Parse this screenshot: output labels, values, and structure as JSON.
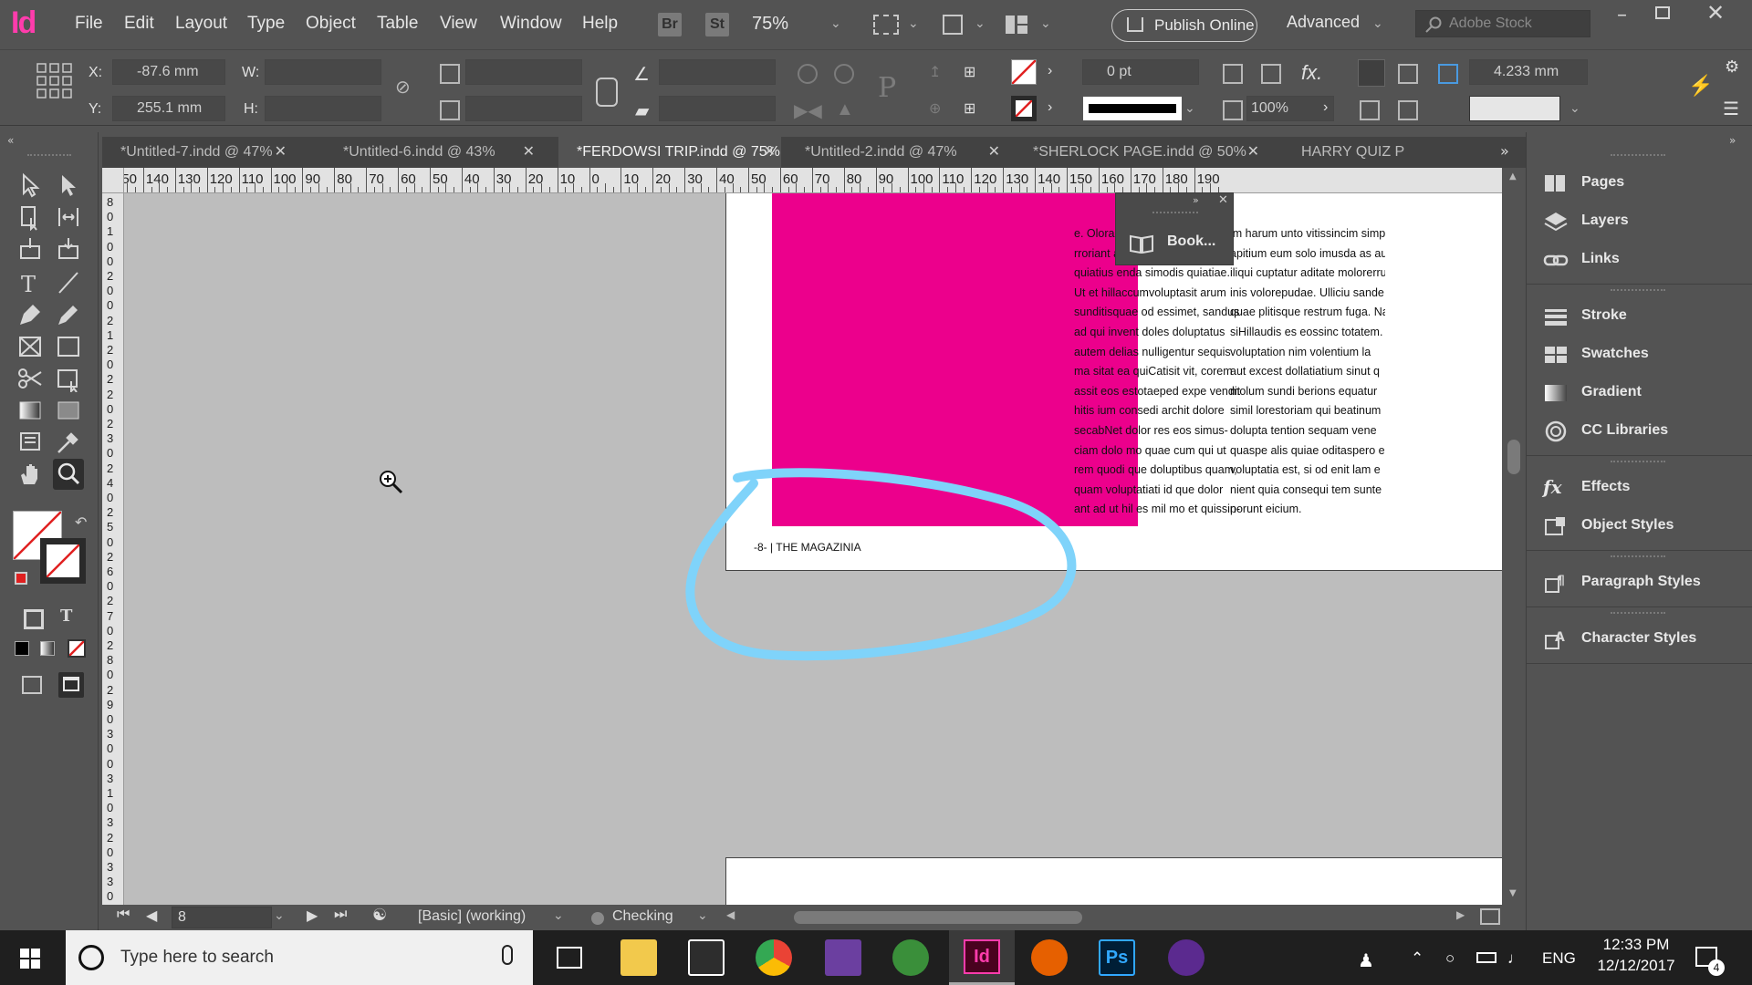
{
  "app": {
    "logo": "Id",
    "menu": [
      "File",
      "Edit",
      "Layout",
      "Type",
      "Object",
      "Table",
      "View",
      "Window",
      "Help"
    ],
    "bridge_label": "Br",
    "stock_label": "St",
    "zoom": "75%",
    "publish_label": "Publish Online",
    "workspace": "Advanced",
    "stock_search_placeholder": "Adobe Stock"
  },
  "control": {
    "x_label": "X:",
    "x_value": "-87.6 mm",
    "y_label": "Y:",
    "y_value": "255.1 mm",
    "w_label": "W:",
    "h_label": "H:",
    "stroke_weight": "0 pt",
    "opacity": "100%",
    "gutter_value": "4.233 mm"
  },
  "tabs": [
    {
      "label": "*Untitled-7.indd @ 47%",
      "active": false
    },
    {
      "label": "*Untitled-6.indd @ 43%",
      "active": false
    },
    {
      "label": "*FERDOWSI TRIP.indd @ 75%",
      "active": true
    },
    {
      "label": "*Untitled-2.indd @ 47%",
      "active": false
    },
    {
      "label": "*SHERLOCK PAGE.indd @ 50%",
      "active": false
    },
    {
      "label": "HARRY QUIZ P",
      "active": false
    }
  ],
  "ruler": {
    "h_labels": [
      "150",
      "140",
      "130",
      "120",
      "110",
      "100",
      "90",
      "80",
      "70",
      "60",
      "50",
      "40",
      "30",
      "20",
      "10",
      "0",
      "10",
      "20",
      "30",
      "40",
      "50",
      "60",
      "70",
      "80",
      "90",
      "100",
      "110",
      "120",
      "130",
      "140",
      "150",
      "160",
      "170",
      "180",
      "190"
    ],
    "v_labels": [
      "8",
      "0",
      "1",
      "0",
      "0",
      "2",
      "0",
      "0",
      "2",
      "1",
      "2",
      "0",
      "2",
      "2",
      "0",
      "2",
      "3",
      "0",
      "2",
      "4",
      "0",
      "2",
      "5",
      "0",
      "2",
      "6",
      "0",
      "2",
      "7",
      "0",
      "2",
      "8",
      "0",
      "2",
      "9",
      "0",
      "3",
      "0",
      "0",
      "3",
      "1",
      "0",
      "3",
      "2",
      "0",
      "3",
      "3",
      "0"
    ]
  },
  "document": {
    "folio": "-8- | THE MAGAZINIA",
    "column1_lines": [
      "e. Olora dusapid",
      "rroriant aut venis",
      "quiatius enda simodis quiatiae.",
      "Ut et hillaccumvoluptasit arum",
      "sunditisquae od essimet, sandus",
      "ad qui invent doles doluptatus",
      "autem delias nulligentur sequis",
      "ma sitat ea quiCatisit vit, corem",
      "assit eos estotaeped expe vendit",
      "hitis ium consedi archit dolore",
      "secabNet dolor res eos simus-",
      "ciam dolo mo quae cum qui ut",
      "rem quodi que doluptibus quam,",
      "quam voluptatiati id que dolor",
      "ant ad ut hil es mil mo et quissin-"
    ],
    "column2_lines": [
      "im harum unto vitissincim simp",
      "apitium eum solo imusda as aut",
      "iliqui cuptatur aditate molorerru",
      "inis volorepudae. Ulliciu sande",
      "quae plitisque restrum fuga. Na",
      "siHillaudis es eossinc totatem.",
      "voluptation nim volentium la",
      "aut excest dollatiatium sinut q",
      "molum sundi berions equatur",
      "simil lorestoriam qui beatinum",
      "dolupta tention sequam vene",
      "quaspe alis quiae oditaspero e",
      "voluptatia est, si od enit lam e",
      "nient quia consequi tem sunte",
      "porunt eicium."
    ],
    "pink_color": "#ec008c",
    "scribble_color": "#7fd3fa"
  },
  "floating_panel": {
    "label": "Book..."
  },
  "right_panel": {
    "groups": [
      [
        "Pages",
        "Layers",
        "Links"
      ],
      [
        "Stroke",
        "Swatches",
        "Gradient",
        "CC Libraries"
      ],
      [
        "Effects",
        "Object Styles"
      ],
      [
        "Paragraph Styles"
      ],
      [
        "Character Styles"
      ]
    ]
  },
  "status": {
    "page_number": "8",
    "style": "[Basic] (working)",
    "preflight": "Checking"
  },
  "taskbar": {
    "search_placeholder": "Type here to search",
    "language": "ENG",
    "time": "12:33 PM",
    "date": "12/12/2017",
    "notifications": "4"
  }
}
